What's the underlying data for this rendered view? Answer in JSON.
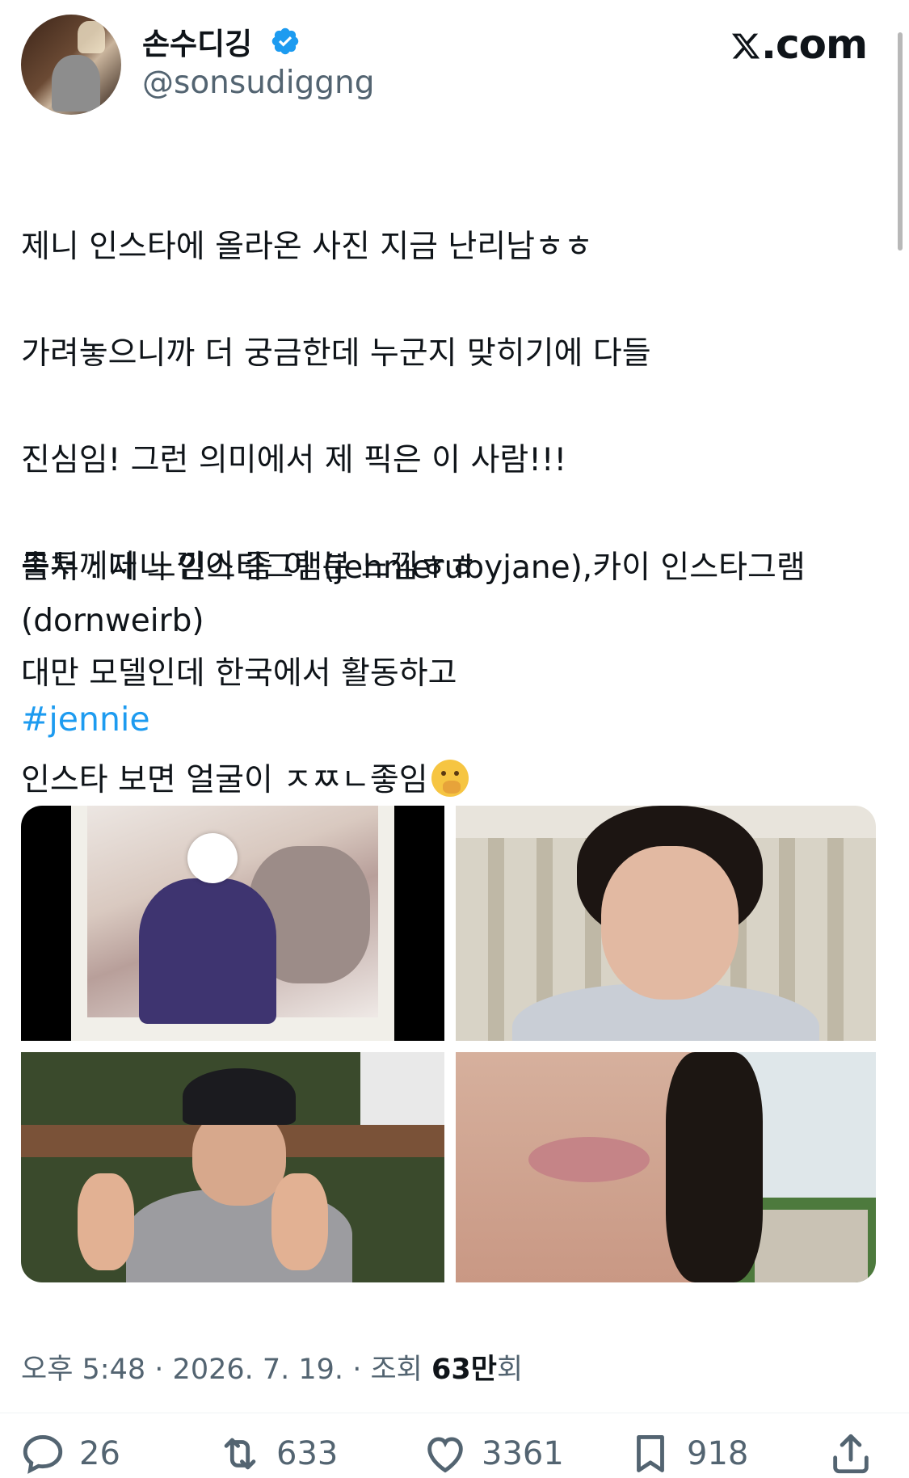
{
  "author": {
    "display_name": "손수디깅",
    "handle": "@sonsudiggng",
    "verified": true,
    "verified_color": "#1d9bf0"
  },
  "brand": {
    "logo_text": ".com",
    "logo_icon": "x-logo-icon"
  },
  "tweet": {
    "lines": [
      "제니 인스타에 올라온 사진 지금 난리남ㅎㅎ",
      "가려놓으니까 더 궁금한데 누군지 맞히기에 다들",
      "진심임! 그런 의미에서 제 픽은 이 사람!!!",
      "목두께나 느낌이 좀 이 분 느낌ㅎㅎ",
      "대만 모델인데 한국에서 활동하고",
      "인스타 보면 얼굴이 ㅈㅉㄴ좋임"
    ],
    "emoji": "hand-over-mouth-emoji",
    "source": "출처 : 제니 인스타그램(jennierubyjane),카이 인스타그램(dornweirb)",
    "hashtag": "#jennie"
  },
  "meta": {
    "time": "오후 5:48",
    "date": "2026. 7. 19.",
    "views_label": "조회",
    "views_count": "63만",
    "views_suffix": "회"
  },
  "actions": {
    "replies": "26",
    "retweets": "633",
    "likes": "3361",
    "bookmarks": "918"
  },
  "colors": {
    "text": "#0f1419",
    "secondary": "#536471",
    "link": "#1d9bf0"
  }
}
